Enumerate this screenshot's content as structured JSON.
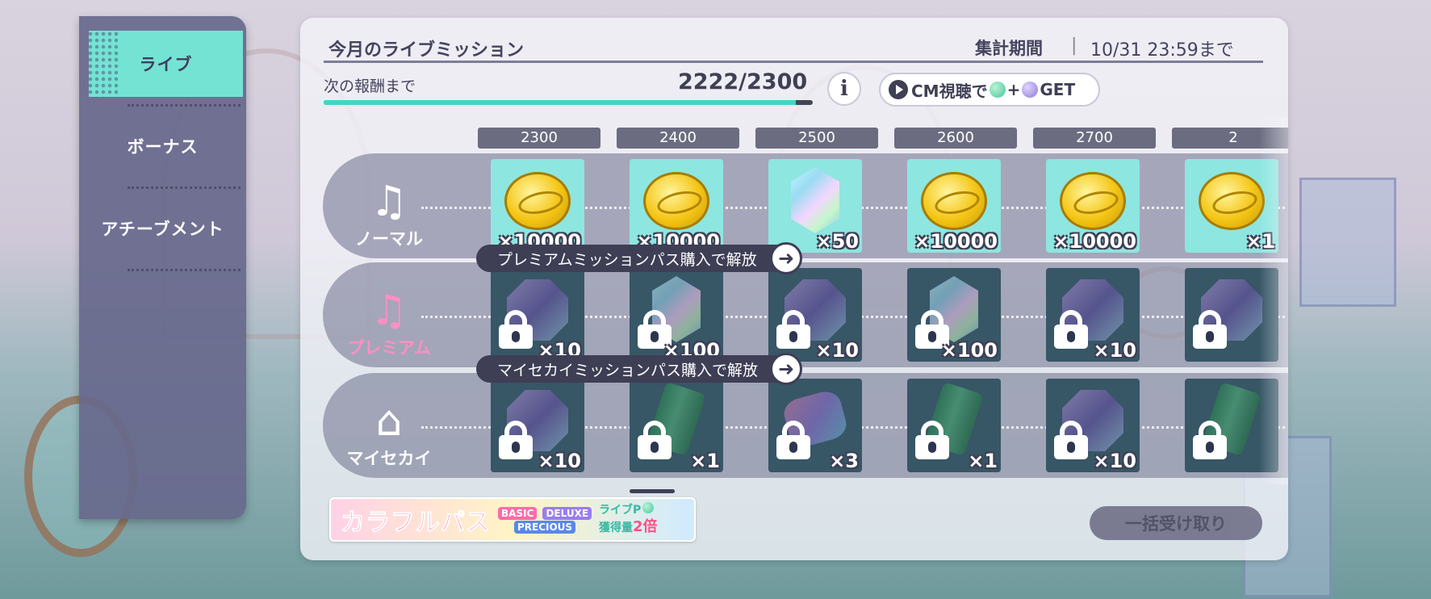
{
  "sidebar": {
    "items": [
      {
        "label": "ライブ",
        "active": true
      },
      {
        "label": "ボーナス",
        "active": false
      },
      {
        "label": "アチーブメント",
        "active": false
      }
    ]
  },
  "header": {
    "title": "今月のライブミッション",
    "period_label": "集計期間",
    "period_separator": "|",
    "period_end": "10/31 23:59まで"
  },
  "progress": {
    "label": "次の報酬まで",
    "text": "2222/2300",
    "fraction": 0.9661
  },
  "info_button": {
    "label": "i"
  },
  "cm_button": {
    "prefix": "CM視聴で",
    "plus": "+",
    "suffix": "GET"
  },
  "thresholds": [
    "2300",
    "2400",
    "2500",
    "2600",
    "2700",
    "2"
  ],
  "rows": [
    {
      "name": "ノーマル",
      "locked": false,
      "unlock_text": "",
      "rewards": [
        {
          "item": "coin",
          "qty": "×10000"
        },
        {
          "item": "coin",
          "qty": "×10000"
        },
        {
          "item": "crystal",
          "qty": "×50"
        },
        {
          "item": "coin",
          "qty": "×10000"
        },
        {
          "item": "coin",
          "qty": "×10000"
        },
        {
          "item": "coin",
          "qty": "×1"
        }
      ]
    },
    {
      "name": "プレミアム",
      "locked": true,
      "unlock_text": "プレミアムミッションパス購入で解放",
      "rewards": [
        {
          "item": "gem",
          "qty": "×10"
        },
        {
          "item": "crystal",
          "qty": "×100"
        },
        {
          "item": "gem",
          "qty": "×10"
        },
        {
          "item": "crystal",
          "qty": "×100"
        },
        {
          "item": "gem",
          "qty": "×10"
        },
        {
          "item": "gem",
          "qty": ""
        }
      ]
    },
    {
      "name": "マイセカイ",
      "locked": true,
      "unlock_text": "マイセカイミッションパス購入で解放",
      "rewards": [
        {
          "item": "gem",
          "qty": "×10"
        },
        {
          "item": "can",
          "qty": "×1"
        },
        {
          "item": "candy",
          "qty": "×3"
        },
        {
          "item": "can",
          "qty": "×1"
        },
        {
          "item": "gem",
          "qty": "×10"
        },
        {
          "item": "can",
          "qty": ""
        }
      ]
    }
  ],
  "pass_banner": {
    "title": "カラフルパス",
    "tags": [
      "BASIC",
      "DELUXE",
      "PRECIOUS"
    ],
    "bonus_line1": "ライブP",
    "bonus_line2": "獲得量",
    "bonus_mult": "2倍"
  },
  "bulk_button": {
    "label": "一括受け取り"
  },
  "colors": {
    "accent_teal": "#74e3d4",
    "sidebar": "#67688c",
    "progress_fill": "#42d6c4",
    "dark_text": "#44445e"
  }
}
